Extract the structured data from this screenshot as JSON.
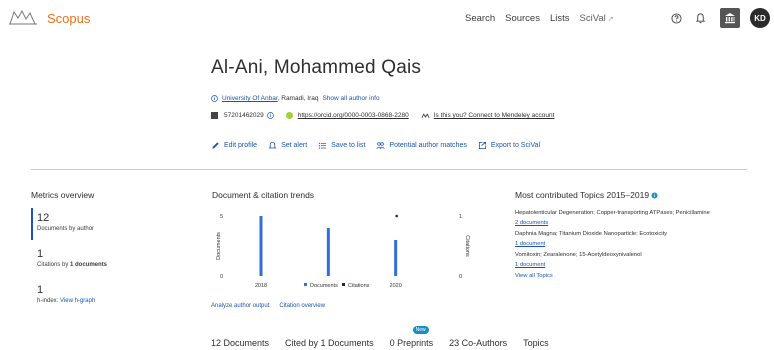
{
  "brand": "Scopus",
  "nav": [
    "Search",
    "Sources",
    "Lists",
    "SciVal"
  ],
  "nav_ext": "↗",
  "user_initials": "KD",
  "author": {
    "name": "Al-Ani, Mohammed Qais",
    "affiliation_link": "University Of Anbar",
    "affiliation_rest": ", Ramadi, Iraq",
    "show_all_info": "Show all author info",
    "scopus_id": "57201462029",
    "orcid": "https://orcid.org/0000-0003-0868-2280",
    "mendeley": "Is this you? Connect to Mendeley account"
  },
  "actions": [
    "Edit profile",
    "Set alert",
    "Save to list",
    "Potential author matches",
    "Export to SciVal"
  ],
  "metrics": {
    "title": "Metrics overview",
    "documents_value": "12",
    "documents_label": "Documents by author",
    "citations_value": "1",
    "citations_label_pre": "Citations by ",
    "citations_label_bold": "1 documents",
    "hindex_value": "1",
    "hindex_label": "h-index:",
    "hindex_link": "View h-graph"
  },
  "trends_title": "Document & citation trends",
  "chart_data": {
    "type": "bar",
    "categories": [
      "2018",
      "2019",
      "2020"
    ],
    "x_tick_labels": [
      "2018",
      "2020"
    ],
    "series": [
      {
        "name": "Documents",
        "values": [
          5,
          4,
          3
        ],
        "color": "#2f6fd6"
      },
      {
        "name": "Citations",
        "values": [
          0,
          0,
          1
        ],
        "color": "#1b2a4a"
      }
    ],
    "ylabel_left": "Documents",
    "ylabel_right": "Citations",
    "left_ticks": [
      "0",
      "5"
    ],
    "right_ticks": [
      "0",
      "1"
    ],
    "ylim_left": [
      0,
      5
    ],
    "ylim_right": [
      0,
      1
    ]
  },
  "chart_links": [
    "Analyze author output",
    "Citation overview"
  ],
  "topics": {
    "title": "Most contributed Topics 2015–2019",
    "items": [
      {
        "name": "Hepatolenticular Degeneration; Copper-transporting ATPases; Penicillamine",
        "docs": "2 documents"
      },
      {
        "name": "Daphnia Magna; Titanium Dioxide Nanoparticle; Ecotoxicity",
        "docs": "1 document"
      },
      {
        "name": "Vomitoxin; Zearalenone; 15-Acetyldeoxynivalenol",
        "docs": "1 document"
      }
    ],
    "view_all": "View all Topics"
  },
  "tabs": {
    "documents": "12 Documents",
    "cited_by": "Cited by 1 Documents",
    "preprints": "0 Preprints",
    "new_badge": "New",
    "coauthors": "23 Co-Authors",
    "topics": "Topics"
  }
}
